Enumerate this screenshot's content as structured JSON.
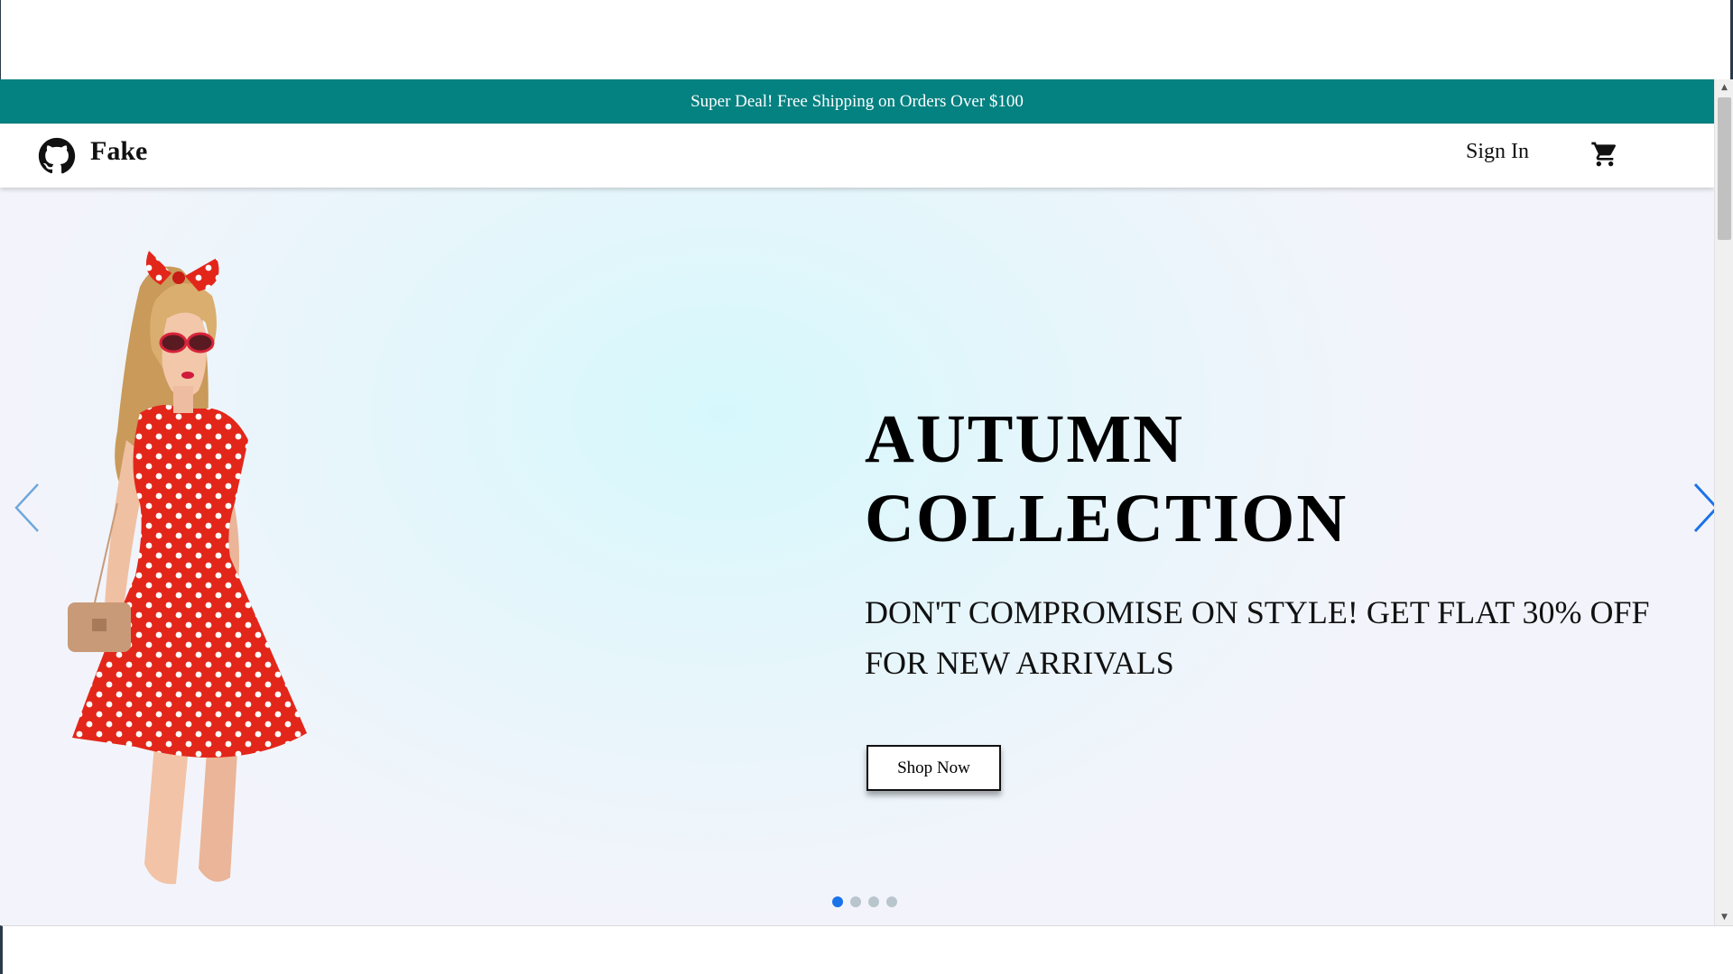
{
  "announcement": {
    "text": "Super Deal! Free Shipping on Orders Over $100",
    "background": "#048181"
  },
  "navbar": {
    "logo_icon": "github-icon",
    "brand": "Fake",
    "sign_in": "Sign In",
    "cart_icon": "shopping-cart-icon"
  },
  "hero": {
    "title_line1": "AUTUMN",
    "title_line2": "COLLECTION",
    "subtitle": "DON'T COMPROMISE ON STYLE! GET FLAT 30% OFF FOR NEW ARRIVALS",
    "button": "Shop Now",
    "prev_icon": "chevron-left-icon",
    "next_icon": "chevron-right-icon",
    "slides_total": 4,
    "active_slide": 1,
    "active_dot_color": "#1a73e8"
  }
}
